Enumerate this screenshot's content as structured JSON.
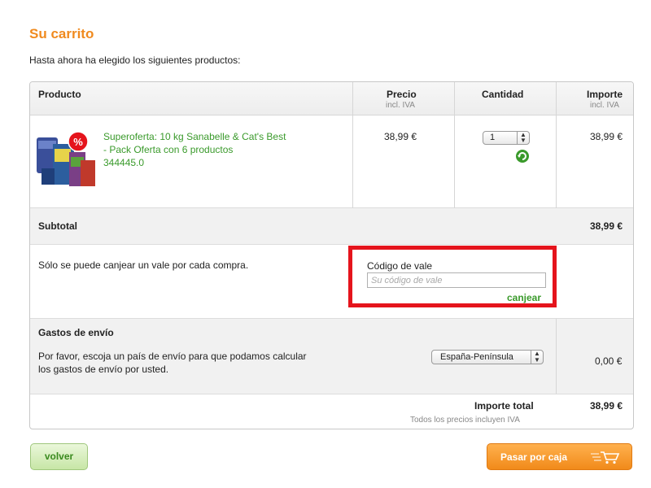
{
  "page": {
    "title": "Su carrito",
    "intro": "Hasta ahora ha elegido los siguientes productos:"
  },
  "table": {
    "headers": {
      "product": "Producto",
      "price": "Precio",
      "price_sub": "incl. IVA",
      "quantity": "Cantidad",
      "amount": "Importe",
      "amount_sub": "incl. IVA"
    },
    "items": [
      {
        "name_line1": "Superoferta: 10 kg Sanabelle & Cat's Best",
        "name_line2": "- Pack Oferta con 6 productos",
        "sku": "344445.0",
        "price": "38,99 €",
        "quantity": "1",
        "amount": "38,99 €"
      }
    ]
  },
  "subtotal": {
    "label": "Subtotal",
    "value": "38,99 €"
  },
  "voucher": {
    "note": "Sólo se puede canjear un vale por cada compra.",
    "label": "Código de vale",
    "placeholder": "Su código de vale",
    "redeem_label": "canjear"
  },
  "shipping": {
    "label": "Gastos de envío",
    "description_line1": "Por favor, escoja un país de envío para que podamos calcular",
    "description_line2": "los gastos de envío por usted.",
    "country": "España-Península",
    "value": "0,00 €"
  },
  "total": {
    "label": "Importe total",
    "note": "Todos los precios incluyen IVA",
    "value": "38,99 €"
  },
  "buttons": {
    "back": "volver",
    "checkout": "Pasar por caja"
  },
  "icons": {
    "sale_badge": "percent-badge-icon",
    "refresh": "refresh-icon",
    "checkout": "shopping-cart-icon"
  },
  "colors": {
    "title": "#f08a1e",
    "link_green": "#3a9a2b",
    "highlight": "#e5141c",
    "checkout_orange": "#f18a1a",
    "back_green": "#c7e6a6"
  }
}
